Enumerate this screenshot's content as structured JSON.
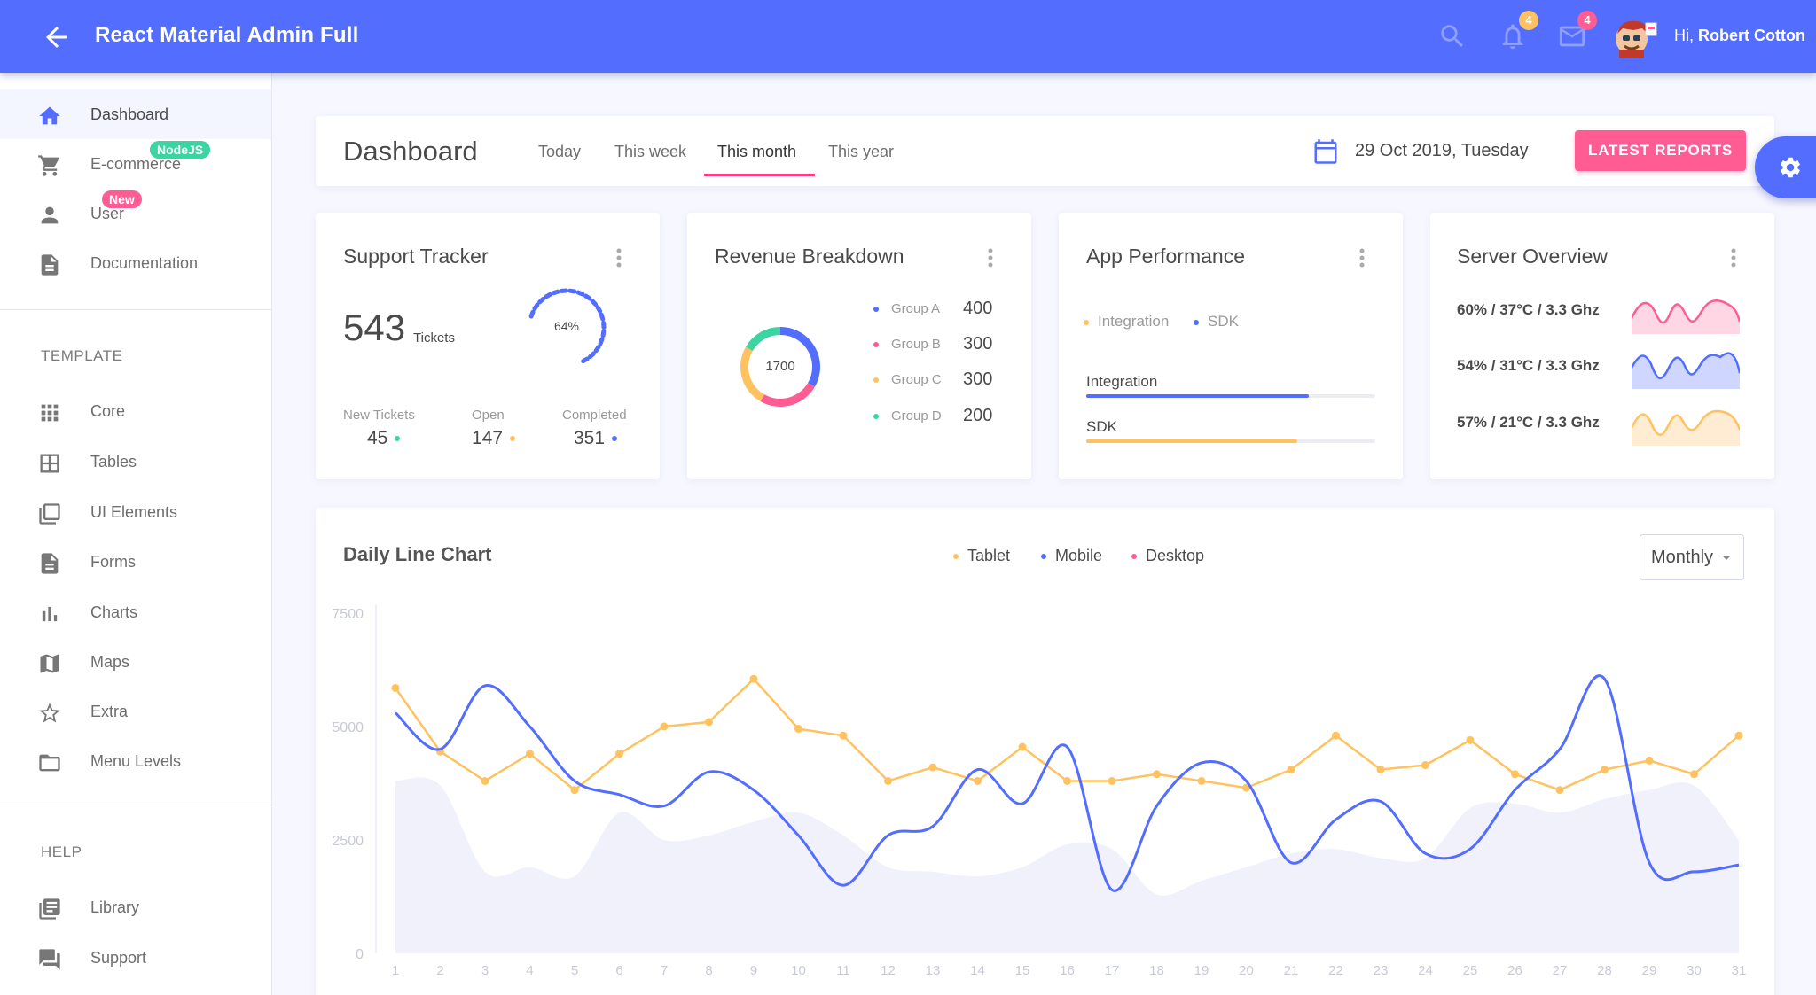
{
  "header": {
    "title": "React Material Admin Full",
    "notifications_count": "4",
    "messages_count": "4",
    "greeting_prefix": "Hi, ",
    "user_name": "Robert Cotton",
    "color": "#536dfe"
  },
  "sidebar": {
    "items": [
      {
        "label": "Dashboard",
        "icon": "home-icon",
        "active": true
      },
      {
        "label": "E-commerce",
        "icon": "cart-icon",
        "badge": "NodeJS",
        "badge_color": "#3cd4a0"
      },
      {
        "label": "User",
        "icon": "person-icon",
        "badge": "New",
        "badge_color": "#ff5c93"
      },
      {
        "label": "Documentation",
        "icon": "document-icon"
      }
    ],
    "template_heading": "TEMPLATE",
    "template_items": [
      {
        "label": "Core",
        "icon": "apps-grid-icon"
      },
      {
        "label": "Tables",
        "icon": "table-icon"
      },
      {
        "label": "UI Elements",
        "icon": "library-icon"
      },
      {
        "label": "Forms",
        "icon": "form-document-icon"
      },
      {
        "label": "Charts",
        "icon": "bar-chart-icon"
      },
      {
        "label": "Maps",
        "icon": "map-icon"
      },
      {
        "label": "Extra",
        "icon": "star-icon"
      },
      {
        "label": "Menu Levels",
        "icon": "folder-icon"
      }
    ],
    "help_heading": "HELP",
    "help_items": [
      {
        "label": "Library",
        "icon": "library-books-icon"
      },
      {
        "label": "Support",
        "icon": "forum-icon"
      }
    ]
  },
  "toolbar": {
    "page_title": "Dashboard",
    "tabs": [
      "Today",
      "This week",
      "This month",
      "This year"
    ],
    "active_tab": "This month",
    "date": "29 Oct 2019, Tuesday",
    "reports_button": "LATEST REPORTS"
  },
  "support_tracker": {
    "title": "Support Tracker",
    "tickets": "543",
    "tickets_label": "Tickets",
    "percent_label": "64%",
    "percent_value": 0.64,
    "stats": [
      {
        "label": "New Tickets",
        "value": "45",
        "color": "#3cd4a0"
      },
      {
        "label": "Open",
        "value": "147",
        "color": "#ffc260"
      },
      {
        "label": "Completed",
        "value": "351",
        "color": "#536dfe"
      }
    ]
  },
  "revenue": {
    "title": "Revenue Breakdown",
    "total": "1700",
    "groups": [
      {
        "name": "Group A",
        "value": 400,
        "label": "400",
        "color": "#536dfe"
      },
      {
        "name": "Group B",
        "value": 300,
        "label": "300",
        "color": "#ff5c93"
      },
      {
        "name": "Group C",
        "value": 300,
        "label": "300",
        "color": "#ffc260"
      },
      {
        "name": "Group D",
        "value": 200,
        "label": "200",
        "color": "#3cd4a0"
      }
    ]
  },
  "app_performance": {
    "title": "App Performance",
    "legend": [
      {
        "label": "Integration",
        "color": "#ffc260"
      },
      {
        "label": "SDK",
        "color": "#536dfe"
      }
    ],
    "bars": [
      {
        "label": "Integration",
        "value": 0.77,
        "color": "#536dfe"
      },
      {
        "label": "SDK",
        "value": 0.73,
        "color": "#ffc260"
      }
    ]
  },
  "server_overview": {
    "title": "Server Overview",
    "rows": [
      {
        "text": "60% / 37°C / 3.3 Ghz",
        "color": "#ff5c93",
        "fill": "#ffd6e4"
      },
      {
        "text": "54% / 31°C / 3.3 Ghz",
        "color": "#536dfe",
        "fill": "#cfd6ff"
      },
      {
        "text": "57% / 21°C / 3.3 Ghz",
        "color": "#ffc260",
        "fill": "#ffecd2"
      }
    ]
  },
  "daily_chart": {
    "title": "Daily Line Chart",
    "select_value": "Monthly",
    "legend": [
      {
        "label": "Tablet",
        "color": "#ffc260"
      },
      {
        "label": "Mobile",
        "color": "#536dfe"
      },
      {
        "label": "Desktop",
        "color": "#ff5c93"
      }
    ]
  },
  "chart_data": {
    "type": "line",
    "title": "Daily Line Chart",
    "x": [
      1,
      2,
      3,
      4,
      5,
      6,
      7,
      8,
      9,
      10,
      11,
      12,
      13,
      14,
      15,
      16,
      17,
      18,
      19,
      20,
      21,
      22,
      23,
      24,
      25,
      26,
      27,
      28,
      29,
      30,
      31
    ],
    "ylim": [
      0,
      7500
    ],
    "yticks": [
      0,
      2500,
      5000,
      7500
    ],
    "series": [
      {
        "name": "Tablet",
        "type": "line",
        "color": "#ffc260",
        "values": [
          5850,
          4450,
          3800,
          4400,
          3600,
          4400,
          5000,
          5100,
          6050,
          4950,
          4800,
          3800,
          4100,
          3800,
          4550,
          3800,
          3800,
          3950,
          3800,
          3650,
          4050,
          4800,
          4050,
          4150,
          4700,
          3950,
          3600,
          4050,
          4250,
          3950,
          4800
        ]
      },
      {
        "name": "Mobile",
        "type": "line",
        "color": "#536dfe",
        "values": [
          5300,
          4500,
          5900,
          5000,
          3800,
          3500,
          3250,
          4000,
          3600,
          2600,
          1500,
          2600,
          2800,
          4050,
          3300,
          4550,
          1400,
          3250,
          4200,
          3800,
          2000,
          2950,
          3350,
          2200,
          2300,
          3600,
          4500,
          6050,
          2000,
          1800,
          1950
        ]
      },
      {
        "name": "Desktop",
        "type": "area",
        "color": "#e8eaf8",
        "values": [
          3800,
          3700,
          1800,
          1900,
          1700,
          3100,
          2500,
          2600,
          2900,
          3100,
          2600,
          1900,
          1800,
          1700,
          1900,
          2400,
          2300,
          1300,
          1600,
          1900,
          2200,
          2300,
          2100,
          2100,
          3200,
          3300,
          3100,
          3400,
          3600,
          3700,
          2500
        ]
      }
    ]
  }
}
